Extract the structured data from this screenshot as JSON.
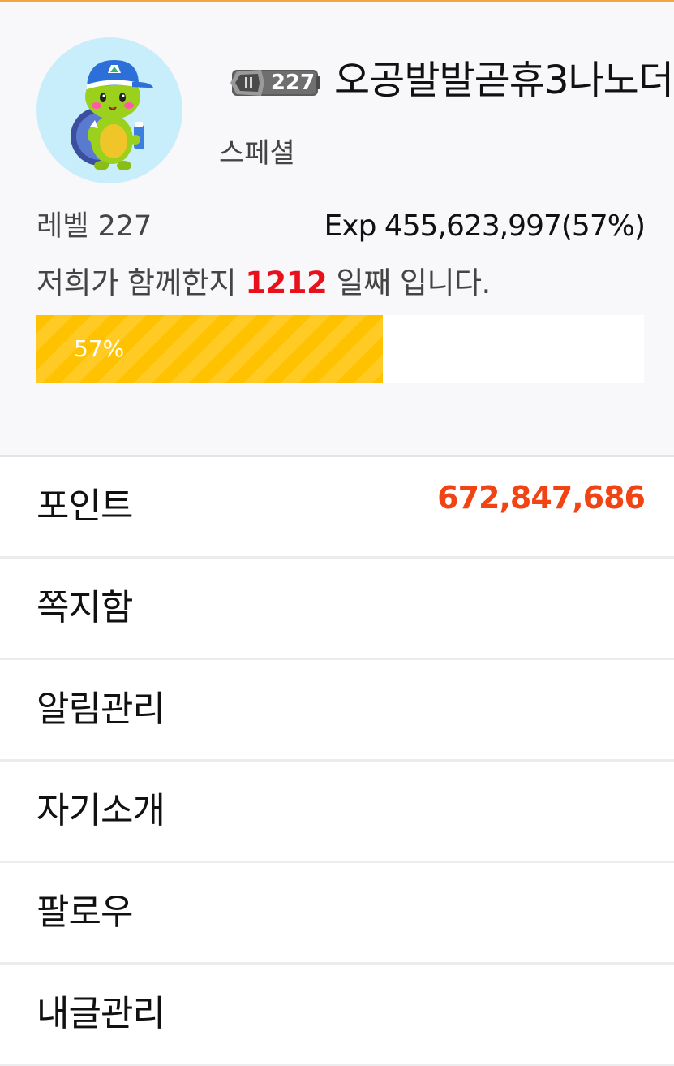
{
  "profile": {
    "level_badge": "227",
    "nickname": "오공발발곧휴3나노더",
    "grade": "스페셜",
    "level_text": "레벨 227",
    "exp_text": "Exp 455,623,997(57%)",
    "together_prefix": "저희가 함께한지 ",
    "together_days": "1212",
    "together_suffix": " 일째 입니다.",
    "progress_value": 57,
    "progress_label": "57%"
  },
  "menu": {
    "items": [
      {
        "label": "포인트",
        "value": "672,847,686"
      },
      {
        "label": "쪽지함"
      },
      {
        "label": "알림관리"
      },
      {
        "label": "자기소개"
      },
      {
        "label": "팔로우"
      },
      {
        "label": "내글관리"
      }
    ]
  },
  "colors": {
    "accent_orange": "#f4a640",
    "progress_fill": "#ffc200",
    "days_red": "#e8111b",
    "points_red": "#f04415"
  },
  "icons": {
    "avatar": "turtle-character-avatar",
    "level_badge": "level-rank-badge-icon"
  }
}
